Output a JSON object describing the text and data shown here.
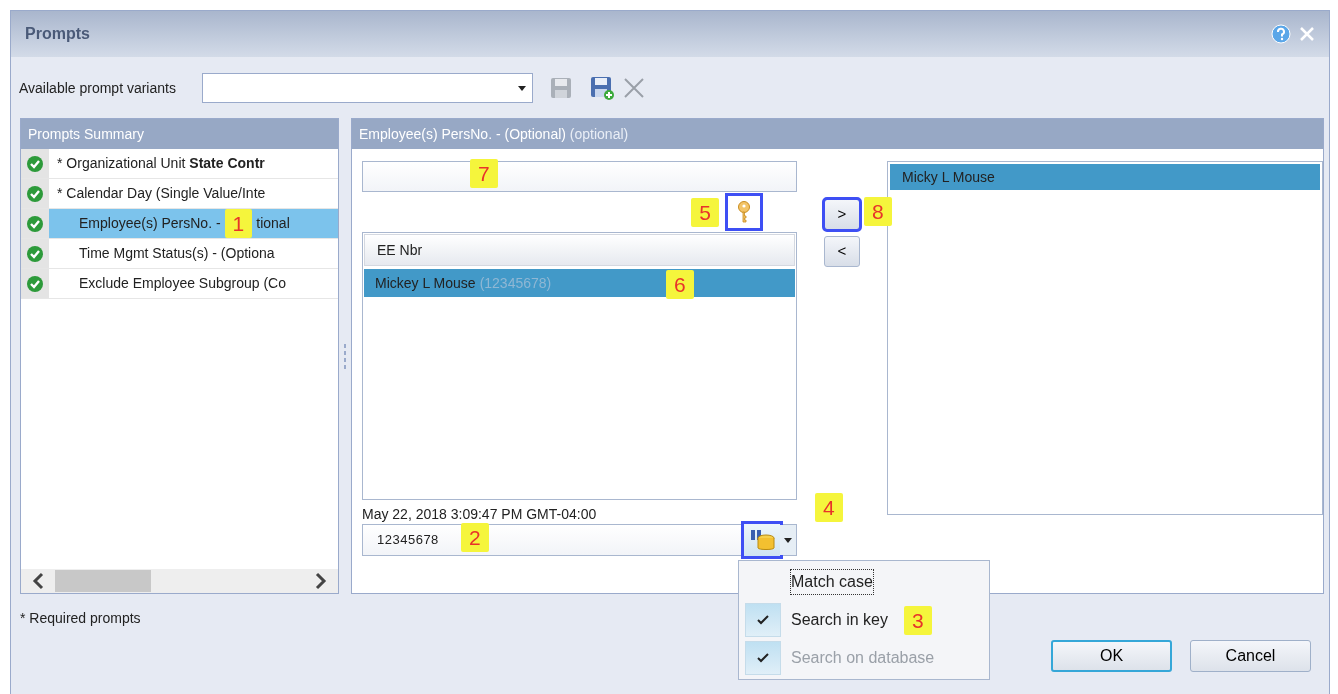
{
  "window": {
    "title": "Prompts"
  },
  "variants": {
    "label": "Available prompt variants"
  },
  "summary": {
    "title": "Prompts Summary",
    "items": [
      {
        "text": "* Organizational Unit **State Contr**",
        "selected": false
      },
      {
        "text": "* Calendar Day (Single Value/Inte",
        "selected": false
      },
      {
        "text": "Employee(s) PersNo. -",
        "text_after": "tional",
        "selected": true,
        "callout": "1"
      },
      {
        "text": "Time Mgmt Status(s) - (Optiona",
        "selected": false
      },
      {
        "text": "Exclude Employee Subgroup (Co",
        "selected": false
      }
    ]
  },
  "detail": {
    "title": "Employee(s) PersNo. - (Optional)",
    "title_note": "(optional)",
    "search_field": {
      "callout": "7"
    },
    "key_button": {
      "highlighted": true,
      "callout": "5"
    },
    "list": {
      "header": "EE Nbr",
      "rows": [
        {
          "name": "Mickey L Mouse",
          "key": "(12345678)",
          "selected": true,
          "callout": "6"
        }
      ]
    },
    "timestamp": "May 22, 2018 3:09:47 PM GMT-04:00",
    "value_field": {
      "value": "12345678",
      "callout": "2"
    },
    "search_button": {
      "highlighted": true,
      "callout": "4"
    },
    "move_buttons": [
      {
        "label": ">",
        "highlighted": true,
        "callout": "8"
      },
      {
        "label": "<",
        "highlighted": false
      }
    ],
    "selected_list": [
      {
        "name": "Micky L Mouse",
        "selected": true
      }
    ]
  },
  "search_menu": [
    {
      "label": "Match case",
      "checked": false,
      "disabled": false,
      "focused": true
    },
    {
      "label": "Search in key",
      "checked": true,
      "disabled": false,
      "focused": false,
      "callout": "3"
    },
    {
      "label": "Search on database",
      "checked": true,
      "disabled": true,
      "focused": false
    }
  ],
  "footnote": "* Required prompts",
  "buttons": [
    {
      "label": "OK",
      "default": true
    },
    {
      "label": "Cancel",
      "default": false
    }
  ]
}
